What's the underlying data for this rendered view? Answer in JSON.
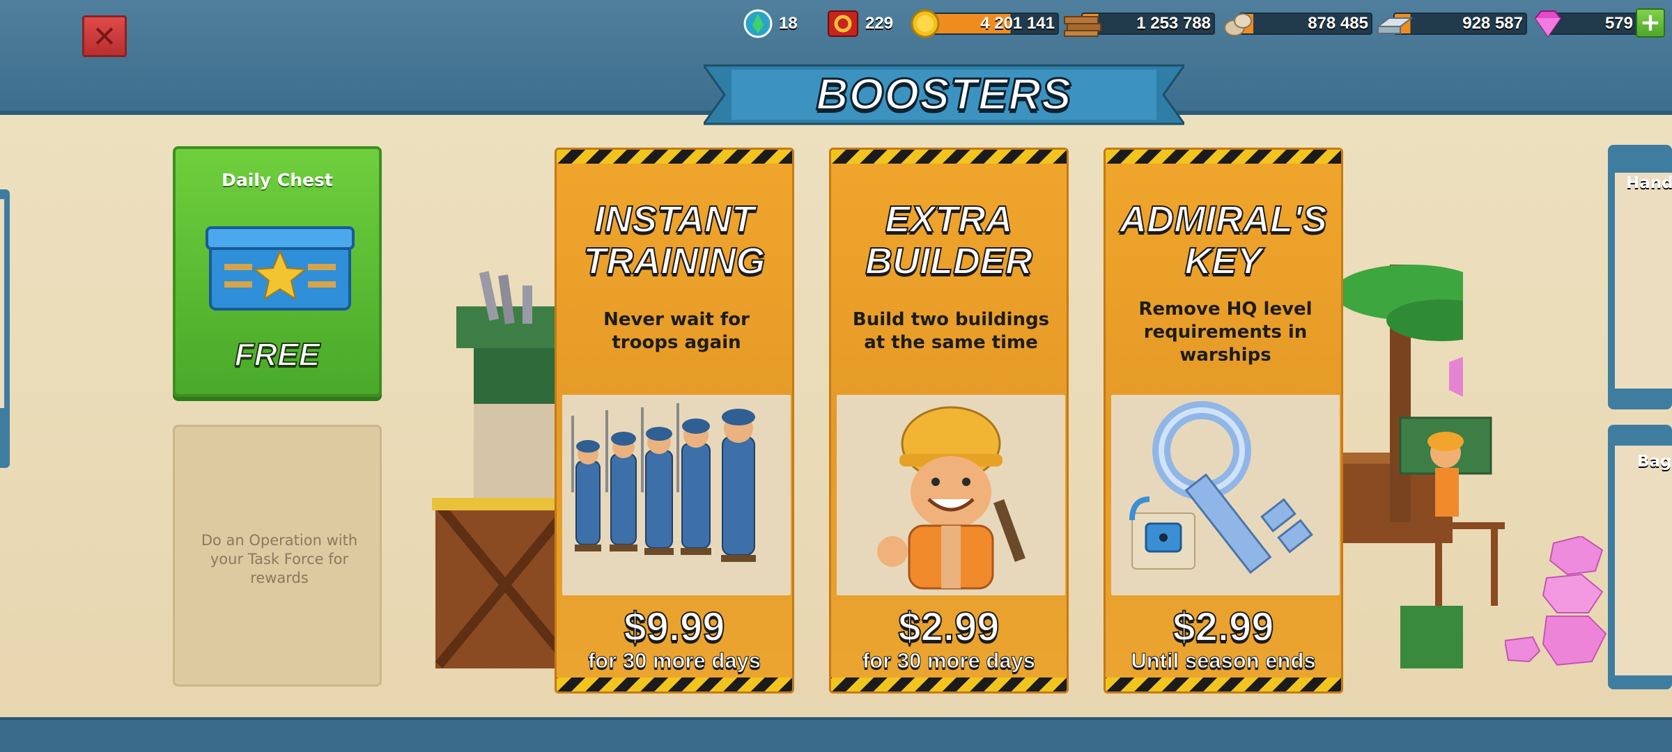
{
  "header": {
    "title": "BOOSTERS",
    "close_label": "✕"
  },
  "resources": {
    "intel": {
      "icon": "intel-icon",
      "value": "18"
    },
    "powder": {
      "icon": "gear-badge-icon",
      "value": "229"
    },
    "gold": {
      "icon": "gold-coin-icon",
      "value": "4 201 141"
    },
    "wood": {
      "icon": "wood-icon",
      "value": "1 253 788"
    },
    "stone": {
      "icon": "stone-icon",
      "value": "878 485"
    },
    "iron": {
      "icon": "iron-icon",
      "value": "928 587"
    },
    "diamonds": {
      "icon": "diamond-icon",
      "value": "579",
      "add_label": "+"
    }
  },
  "daily_chest": {
    "title": "Daily Chest",
    "price_label": "FREE"
  },
  "operation_box": {
    "text": "Do an Operation with your Task Force for rewards"
  },
  "boosters": [
    {
      "title_line1": "INSTANT",
      "title_line2": "TRAINING",
      "description": "Never wait for troops again",
      "price": "$9.99",
      "subtitle": "for 30 more days"
    },
    {
      "title_line1": "EXTRA",
      "title_line2": "BUILDER",
      "description": "Build two buildings at the same time",
      "price": "$2.99",
      "subtitle": "for 30 more days"
    },
    {
      "title_line1": "ADMIRAL'S",
      "title_line2": "KEY",
      "description": "Remove HQ level requirements in warships",
      "price": "$2.99",
      "subtitle": "Until season ends"
    }
  ],
  "side_cards": {
    "right_top_label": "Handi",
    "right_bottom_label": "Bag"
  },
  "colors": {
    "card_orange": "#e9a02a",
    "daily_green": "#5bbd33",
    "frame_blue": "#4a7c9c"
  }
}
